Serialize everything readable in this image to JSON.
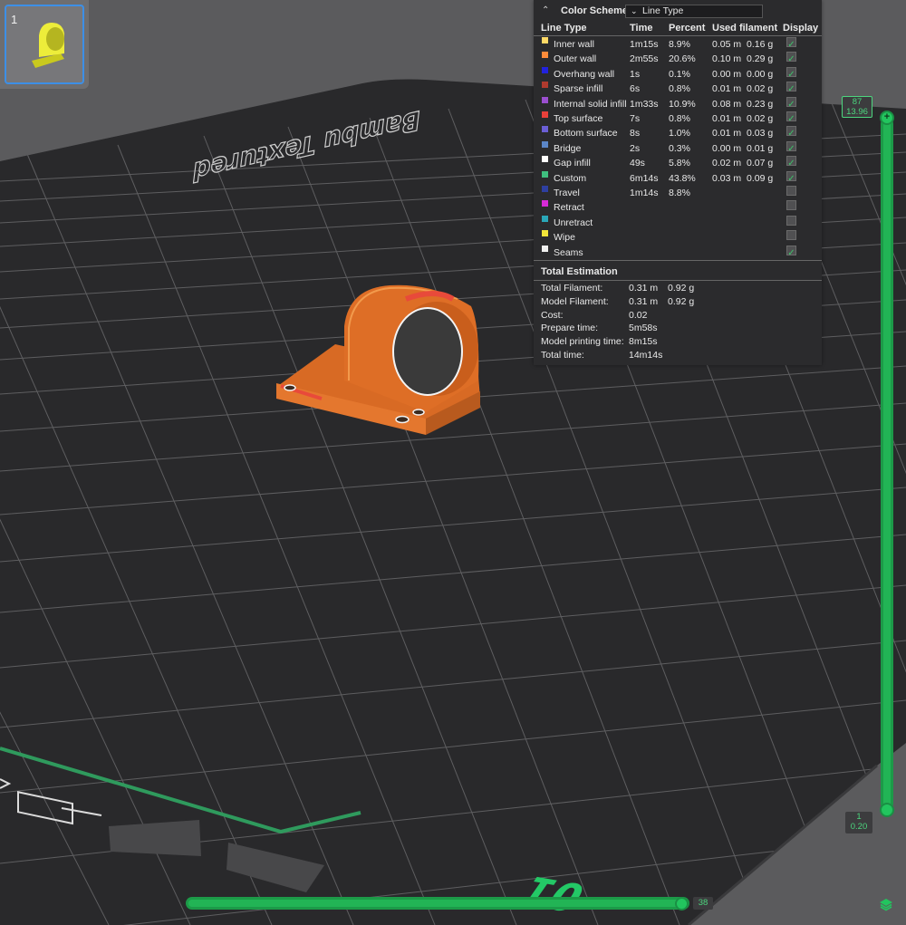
{
  "plate_thumbnail": {
    "number": "1"
  },
  "bed": {
    "brand_text": "Bambu Textured",
    "plate_number": "01"
  },
  "legend": {
    "color_scheme_label": "Color Scheme",
    "selected_scheme": "Line Type",
    "headers": {
      "line_type": "Line Type",
      "time": "Time",
      "percent": "Percent",
      "used_filament": "Used filament",
      "display": "Display"
    },
    "rows": [
      {
        "name": "Inner wall",
        "color": "#ffd966",
        "time": "1m15s",
        "percent": "8.9%",
        "length": "0.05 m",
        "weight": "0.16 g",
        "checked": true
      },
      {
        "name": "Outer wall",
        "color": "#ff8c3a",
        "time": "2m55s",
        "percent": "20.6%",
        "length": "0.10 m",
        "weight": "0.29 g",
        "checked": true
      },
      {
        "name": "Overhang wall",
        "color": "#2222dd",
        "time": "1s",
        "percent": "0.1%",
        "length": "0.00 m",
        "weight": "0.00 g",
        "checked": true
      },
      {
        "name": "Sparse infill",
        "color": "#b03a2e",
        "time": "6s",
        "percent": "0.8%",
        "length": "0.01 m",
        "weight": "0.02 g",
        "checked": true
      },
      {
        "name": "Internal solid infill",
        "color": "#9b4fd0",
        "time": "1m33s",
        "percent": "10.9%",
        "length": "0.08 m",
        "weight": "0.23 g",
        "checked": true
      },
      {
        "name": "Top surface",
        "color": "#e8403a",
        "time": "7s",
        "percent": "0.8%",
        "length": "0.01 m",
        "weight": "0.02 g",
        "checked": true
      },
      {
        "name": "Bottom surface",
        "color": "#6b5fd6",
        "time": "8s",
        "percent": "1.0%",
        "length": "0.01 m",
        "weight": "0.03 g",
        "checked": true
      },
      {
        "name": "Bridge",
        "color": "#5b86c8",
        "time": "2s",
        "percent": "0.3%",
        "length": "0.00 m",
        "weight": "0.01 g",
        "checked": true
      },
      {
        "name": "Gap infill",
        "color": "#ffffff",
        "time": "49s",
        "percent": "5.8%",
        "length": "0.02 m",
        "weight": "0.07 g",
        "checked": true
      },
      {
        "name": "Custom",
        "color": "#3fbf7f",
        "time": "6m14s",
        "percent": "43.8%",
        "length": "0.03 m",
        "weight": "0.09 g",
        "checked": true
      },
      {
        "name": "Travel",
        "color": "#2e3fa0",
        "time": "1m14s",
        "percent": "8.8%",
        "length": "",
        "weight": "",
        "checked": false
      },
      {
        "name": "Retract",
        "color": "#d62ad6",
        "time": "",
        "percent": "",
        "length": "",
        "weight": "",
        "checked": false
      },
      {
        "name": "Unretract",
        "color": "#2aa7b8",
        "time": "",
        "percent": "",
        "length": "",
        "weight": "",
        "checked": false
      },
      {
        "name": "Wipe",
        "color": "#f2e53a",
        "time": "",
        "percent": "",
        "length": "",
        "weight": "",
        "checked": false
      },
      {
        "name": "Seams",
        "color": "#f0f0f0",
        "time": "",
        "percent": "",
        "length": "",
        "weight": "",
        "checked": true
      }
    ],
    "total_estimation_title": "Total Estimation",
    "estimation": [
      {
        "label": "Total Filament:",
        "value": "0.31 m",
        "extra": "0.92 g"
      },
      {
        "label": "Model Filament:",
        "value": "0.31 m",
        "extra": "0.92 g"
      },
      {
        "label": "Cost:",
        "value": "0.02",
        "extra": ""
      },
      {
        "label": "Prepare time:",
        "value": "5m58s",
        "extra": ""
      },
      {
        "label": "Model printing time:",
        "value": "8m15s",
        "extra": ""
      },
      {
        "label": "Total time:",
        "value": "14m14s",
        "extra": ""
      }
    ]
  },
  "layer_slider": {
    "top_layer": "87",
    "top_height": "13.96",
    "bottom_layer": "1",
    "bottom_height": "0.20"
  },
  "move_slider": {
    "value": "38"
  },
  "icons": {
    "layers": "layers-icon",
    "collapse": "chevron-up-double-icon",
    "dropdown": "chevron-down-icon"
  }
}
